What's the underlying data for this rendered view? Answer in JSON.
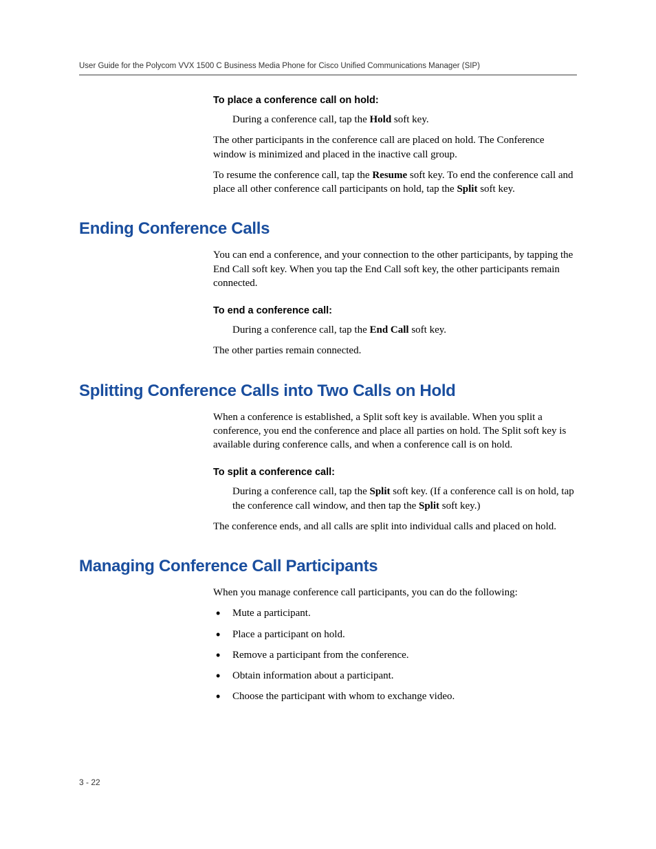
{
  "header": {
    "running_title": "User Guide for the Polycom VVX 1500 C Business Media Phone for Cisco Unified Communications Manager (SIP)"
  },
  "place_hold": {
    "heading": "To place a conference call on hold:",
    "step_pre": "During a conference call, tap the ",
    "step_bold": "Hold",
    "step_post": " soft key.",
    "para1": "The other participants in the conference call are placed on hold. The Conference window is minimized and placed in the inactive call group.",
    "para2_pre": "To resume the conference call, tap the ",
    "para2_b1": "Resume",
    "para2_mid": " soft key. To end the conference call and place all other conference call participants on hold, tap the ",
    "para2_b2": "Split",
    "para2_post": " soft key."
  },
  "ending": {
    "heading": "Ending Conference Calls",
    "intro": "You can end a conference, and your connection to the other participants, by tapping the End Call soft key. When you tap the End Call soft key, the other participants remain connected.",
    "sub_heading": "To end a conference call:",
    "step_pre": "During a conference call, tap the ",
    "step_bold": "End Call",
    "step_post": " soft key.",
    "after": "The other parties remain connected."
  },
  "splitting": {
    "heading": "Splitting Conference Calls into Two Calls on Hold",
    "intro": "When a conference is established, a Split soft key is available. When you split a conference, you end the conference and place all parties on hold. The Split soft key is available during conference calls, and when a conference call is on hold.",
    "sub_heading": "To split a conference call:",
    "step_pre": "During a conference call, tap the ",
    "step_b1": "Split",
    "step_mid": " soft key. (If a conference call is on hold, tap the conference call window, and then tap the ",
    "step_b2": "Split",
    "step_post": " soft key.)",
    "after": "The conference ends, and all calls are split into individual calls and placed on hold."
  },
  "managing": {
    "heading": "Managing Conference Call Participants",
    "intro": "When you manage conference call participants, you can do the following:",
    "bullets": [
      "Mute a participant.",
      "Place a participant on hold.",
      "Remove a participant from the conference.",
      "Obtain information about a participant.",
      "Choose the participant with whom to exchange video."
    ]
  },
  "footer": {
    "page_number": "3 - 22"
  }
}
